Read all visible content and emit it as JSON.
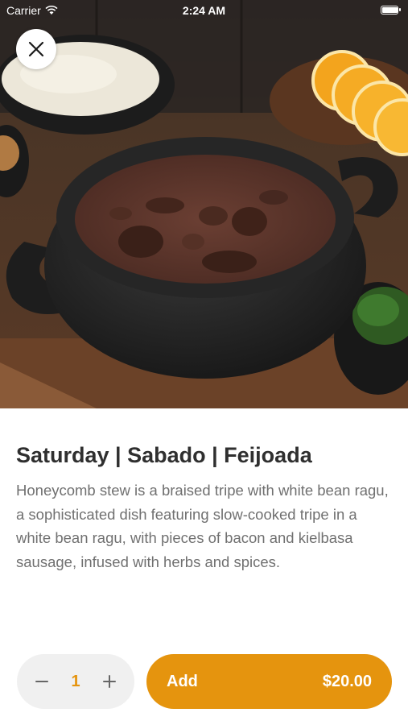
{
  "status_bar": {
    "carrier": "Carrier",
    "time": "2:24 AM",
    "battery_level": 0.95
  },
  "hero": {
    "image_subject": "feijoada-dish-photo"
  },
  "close_button": {
    "icon": "close-icon"
  },
  "dish": {
    "title": "Saturday | Sabado | Feijoada",
    "description": "Honeycomb stew is a braised tripe with white bean ragu, a sophisticated dish featuring slow-cooked tripe in a white bean ragu, with pieces of bacon and kielbasa sausage, infused with herbs and spices."
  },
  "quantity": {
    "value": "1",
    "decrement_icon": "minus-icon",
    "increment_icon": "plus-icon"
  },
  "add_button": {
    "label": "Add",
    "price": "$20.00"
  },
  "colors": {
    "accent": "#e5940e",
    "title": "#2f2f2f",
    "body_text": "#707070",
    "stepper_bg": "#f0f0f0"
  }
}
